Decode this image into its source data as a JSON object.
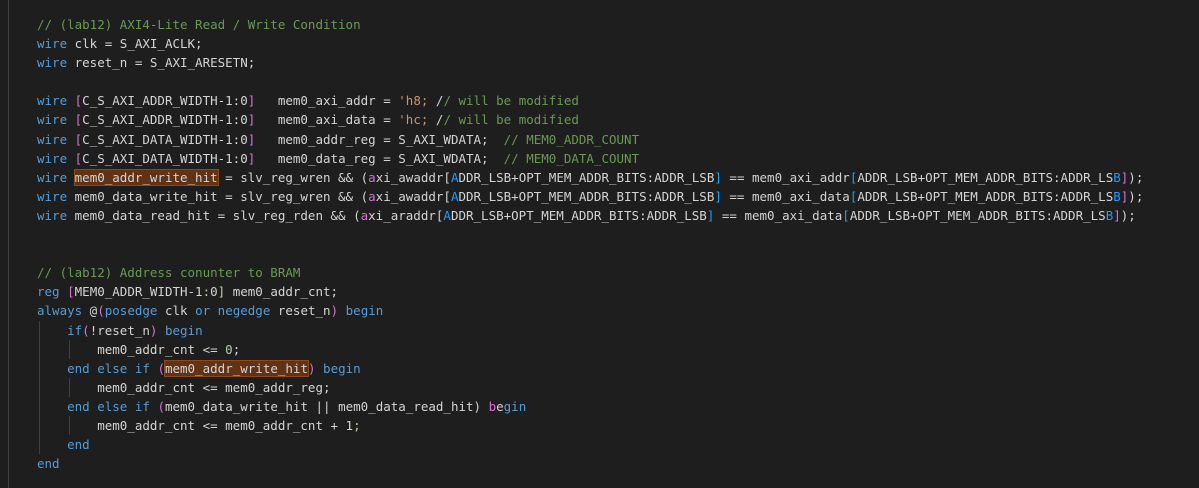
{
  "editor": {
    "lines": [
      "// (lab12) AXI4-Lite Read / Write Condition",
      "wire clk = S_AXI_ACLK;",
      "wire reset_n = S_AXI_ARESETN;",
      "",
      "wire [C_S_AXI_ADDR_WIDTH-1:0]   mem0_axi_addr = 'h8; // will be modified",
      "wire [C_S_AXI_ADDR_WIDTH-1:0]   mem0_axi_data = 'hc; // will be modified",
      "wire [C_S_AXI_DATA_WIDTH-1:0]   mem0_addr_reg = S_AXI_WDATA;  // MEM0_ADDR_COUNT",
      "wire [C_S_AXI_DATA_WIDTH-1:0]   mem0_data_reg = S_AXI_WDATA;  // MEM0_DATA_COUNT",
      "wire mem0_addr_write_hit = slv_reg_wren && (axi_awaddr[ADDR_LSB+OPT_MEM_ADDR_BITS:ADDR_LSB] == mem0_axi_addr[ADDR_LSB+OPT_MEM_ADDR_BITS:ADDR_LSB]);",
      "wire mem0_data_write_hit = slv_reg_wren && (axi_awaddr[ADDR_LSB+OPT_MEM_ADDR_BITS:ADDR_LSB] == mem0_axi_data[ADDR_LSB+OPT_MEM_ADDR_BITS:ADDR_LSB]);",
      "wire mem0_data_read_hit = slv_reg_rden && (axi_araddr[ADDR_LSB+OPT_MEM_ADDR_BITS:ADDR_LSB] == mem0_axi_data[ADDR_LSB+OPT_MEM_ADDR_BITS:ADDR_LSB]);",
      "",
      "",
      "// (lab12) Address conunter to BRAM",
      "reg [MEM0_ADDR_WIDTH-1:0] mem0_addr_cnt;",
      "always @(posedge clk or negedge reset_n) begin",
      "    if(!reset_n) begin",
      "        mem0_addr_cnt <= 0;",
      "    end else if (mem0_addr_write_hit) begin",
      "        mem0_addr_cnt <= mem0_addr_reg;",
      "    end else if (mem0_data_write_hit || mem0_data_read_hit) begin",
      "        mem0_addr_cnt <= mem0_addr_cnt + 1;",
      "    end",
      "end"
    ]
  },
  "colors": {
    "background": "#1e1e1e",
    "keyword": "#569cd6",
    "comment": "#6a9955",
    "number": "#b5cea8",
    "string": "#ce9178",
    "bracket_level1": "#da70d6",
    "bracket_level2": "#179fff",
    "identifier": "#d4d4d4",
    "word_highlight": "#613214"
  }
}
